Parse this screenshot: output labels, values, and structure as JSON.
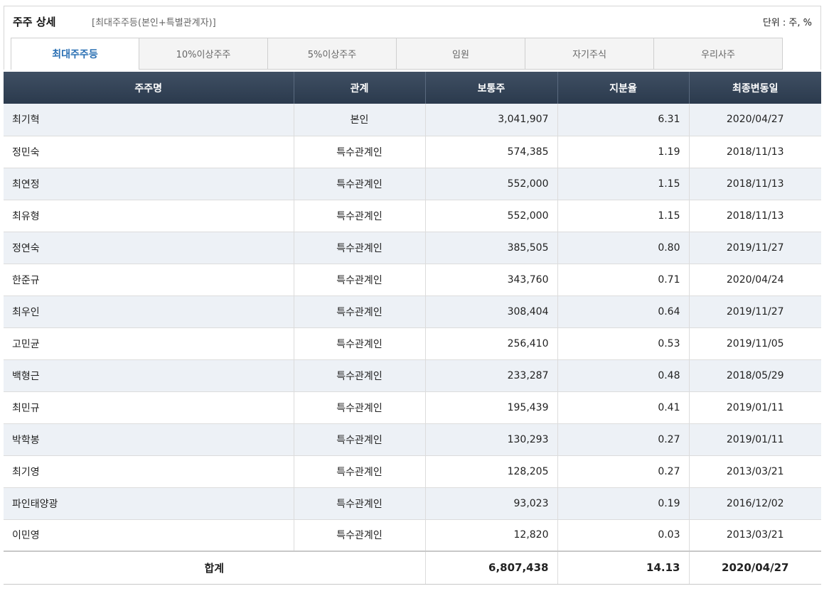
{
  "header": {
    "title": "주주 상세",
    "subtitle": "[최대주주등(본인+특별관계자)]",
    "unit": "단위 : 주, %"
  },
  "tabs": [
    {
      "label": "최대주주등",
      "active": true
    },
    {
      "label": "10%이상주주",
      "active": false
    },
    {
      "label": "5%이상주주",
      "active": false
    },
    {
      "label": "임원",
      "active": false
    },
    {
      "label": "자기주식",
      "active": false
    },
    {
      "label": "우리사주",
      "active": false
    }
  ],
  "table": {
    "columns": [
      "주주명",
      "관계",
      "보통주",
      "지분율",
      "최종변동일"
    ],
    "rows": [
      {
        "name": "최기혁",
        "relation": "본인",
        "shares": "3,041,907",
        "ratio": "6.31",
        "date": "2020/04/27"
      },
      {
        "name": "정민숙",
        "relation": "특수관계인",
        "shares": "574,385",
        "ratio": "1.19",
        "date": "2018/11/13"
      },
      {
        "name": "최연정",
        "relation": "특수관계인",
        "shares": "552,000",
        "ratio": "1.15",
        "date": "2018/11/13"
      },
      {
        "name": "최유형",
        "relation": "특수관계인",
        "shares": "552,000",
        "ratio": "1.15",
        "date": "2018/11/13"
      },
      {
        "name": "정연숙",
        "relation": "특수관계인",
        "shares": "385,505",
        "ratio": "0.80",
        "date": "2019/11/27"
      },
      {
        "name": "한준규",
        "relation": "특수관계인",
        "shares": "343,760",
        "ratio": "0.71",
        "date": "2020/04/24"
      },
      {
        "name": "최우인",
        "relation": "특수관계인",
        "shares": "308,404",
        "ratio": "0.64",
        "date": "2019/11/27"
      },
      {
        "name": "고민균",
        "relation": "특수관계인",
        "shares": "256,410",
        "ratio": "0.53",
        "date": "2019/11/05"
      },
      {
        "name": "백형근",
        "relation": "특수관계인",
        "shares": "233,287",
        "ratio": "0.48",
        "date": "2018/05/29"
      },
      {
        "name": "최민규",
        "relation": "특수관계인",
        "shares": "195,439",
        "ratio": "0.41",
        "date": "2019/01/11"
      },
      {
        "name": "박학봉",
        "relation": "특수관계인",
        "shares": "130,293",
        "ratio": "0.27",
        "date": "2019/01/11"
      },
      {
        "name": "최기영",
        "relation": "특수관계인",
        "shares": "128,205",
        "ratio": "0.27",
        "date": "2013/03/21"
      },
      {
        "name": "파인태양광",
        "relation": "특수관계인",
        "shares": "93,023",
        "ratio": "0.19",
        "date": "2016/12/02"
      },
      {
        "name": "이민영",
        "relation": "특수관계인",
        "shares": "12,820",
        "ratio": "0.03",
        "date": "2013/03/21"
      }
    ],
    "total": {
      "label": "합계",
      "shares": "6,807,438",
      "ratio": "14.13",
      "date": "2020/04/27"
    }
  },
  "colors": {
    "active_tab_text": "#2a6fb3",
    "header_row_bg": "#2b3a4d",
    "striped_row_bg": "#edf1f6"
  }
}
